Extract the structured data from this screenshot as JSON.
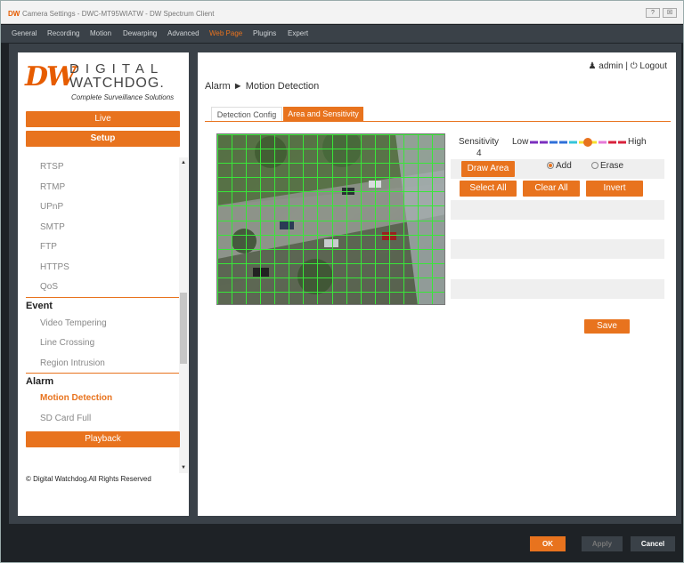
{
  "window": {
    "logo": "DW",
    "title": "Camera Settings - DWC-MT95WIATW - DW Spectrum Client",
    "controls": [
      "?",
      "☒"
    ]
  },
  "menu": {
    "items": [
      "General",
      "Recording",
      "Motion",
      "Dewarping",
      "Advanced",
      "Web Page",
      "Plugins",
      "Expert"
    ],
    "active": "Web Page"
  },
  "brand": {
    "mark": "DW",
    "line1": "DIGITAL",
    "line2": "WATCHDOG.",
    "tagline": "Complete Surveillance Solutions"
  },
  "sidebar": {
    "live": "Live",
    "setup": "Setup",
    "network_items": [
      "RTSP",
      "RTMP",
      "UPnP",
      "SMTP",
      "FTP",
      "HTTPS",
      "QoS"
    ],
    "event_head": "Event",
    "event_items": [
      "Video Tempering",
      "Line Crossing",
      "Region Intrusion"
    ],
    "alarm_head": "Alarm",
    "alarm_items": [
      "Motion Detection",
      "SD Card Full"
    ],
    "active_item": "Motion Detection",
    "playback": "Playback",
    "copyright": "© Digital Watchdog.All Rights Reserved"
  },
  "header": {
    "user": "admin",
    "separator": "|",
    "logout": "Logout",
    "breadcrumb": "Alarm ► Motion Detection"
  },
  "tabs": {
    "items": [
      "Detection Config",
      "Area and Sensitivity"
    ],
    "active": "Area and Sensitivity"
  },
  "sensitivity": {
    "label": "Sensitivity",
    "value": "4",
    "low": "Low",
    "high": "High",
    "level": 4,
    "max": 10,
    "segment_colors": [
      "#7b2fbe",
      "#7b2fbe",
      "#2f6fd8",
      "#2f6fd8",
      "#35c4d9",
      "#f5e030",
      "#f5e030",
      "#e67ad8",
      "#d8213b",
      "#d8213b"
    ]
  },
  "area": {
    "draw_area": "Draw Area",
    "add": "Add",
    "erase": "Erase",
    "mode": "Add",
    "select_all": "Select All",
    "clear_all": "Clear All",
    "invert": "Invert",
    "save": "Save",
    "grid_cols": 16,
    "grid_rows": 12,
    "grid_color": "#39e639"
  },
  "footer": {
    "ok": "OK",
    "apply": "Apply",
    "cancel": "Cancel"
  },
  "colors": {
    "accent": "#e8731e"
  }
}
